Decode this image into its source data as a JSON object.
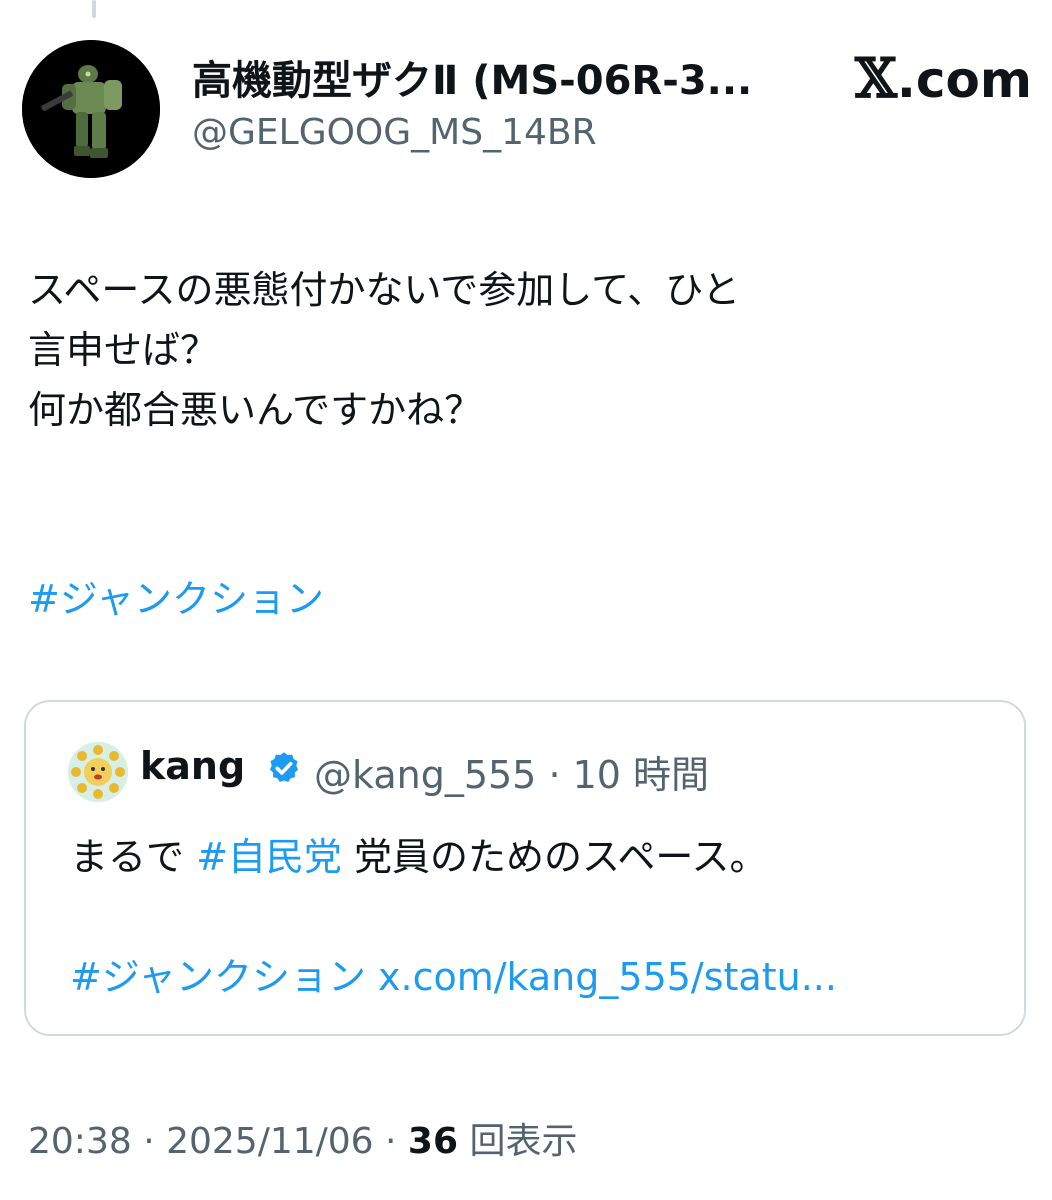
{
  "author": {
    "display_name": "高機動型ザクⅡ (MS-06R-3...",
    "handle": "@GELGOOG_MS_14BR"
  },
  "brand": {
    "symbol": "𝕏",
    "suffix": ".com"
  },
  "tweet": {
    "lines": [
      "スペースの悪態付かないで参加して、ひと",
      "言申せば？",
      "何か都合悪いんですかね？"
    ],
    "hashtag": "#ジャンクション"
  },
  "quote": {
    "name": "kang",
    "handle_time": "@kang_555 · 10 時間",
    "text_prefix": "まるで ",
    "text_hashtag": "#自民党",
    "text_suffix": " 党員のためのスペース。",
    "link_hashtag": "#ジャンクション",
    "link_url": " x.com/kang_555/statu..."
  },
  "meta": {
    "time_date": "20:38 · 2025/11/06 · ",
    "views_count": "36",
    "views_label": " 回表示"
  },
  "colors": {
    "link": "#1d9bf0",
    "secondary": "#536471",
    "verified": "#1d9bf0"
  },
  "icons": {
    "avatar": "robot-avatar-icon",
    "quote_avatar": "sun-face-avatar-icon",
    "verified": "verified-badge-icon"
  }
}
